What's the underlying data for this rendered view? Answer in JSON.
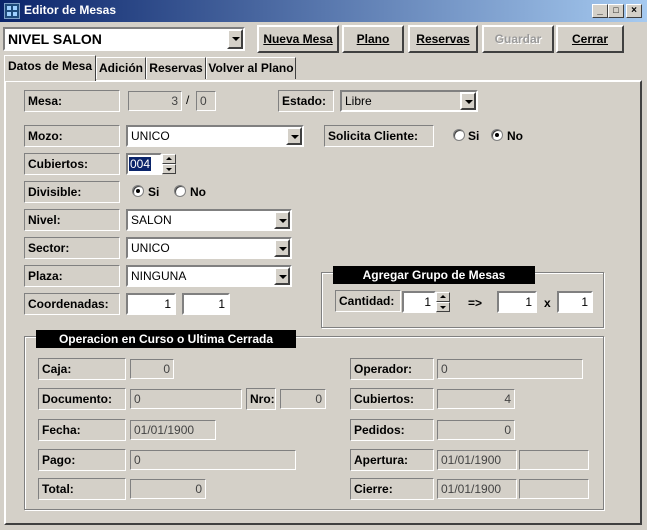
{
  "window": {
    "title": "Editor de Mesas",
    "min": "_",
    "max": "□",
    "close": "×"
  },
  "toolbar": {
    "nivel_value": "NIVEL SALON",
    "nueva_mesa": "Nueva Mesa",
    "plano": "Plano",
    "reservas": "Reservas",
    "guardar": "Guardar",
    "cerrar": "Cerrar"
  },
  "tabs": [
    "Datos de Mesa",
    "Adición",
    "Reservas",
    "Volver al Plano"
  ],
  "form": {
    "mesa_label": "Mesa:",
    "mesa_value": "3",
    "mesa_sep": "/",
    "mesa_value2": "0",
    "estado_label": "Estado:",
    "estado_value": "Libre",
    "mozo_label": "Mozo:",
    "mozo_value": "UNICO",
    "solicita_label": "Solicita Cliente:",
    "si": "Si",
    "no": "No",
    "cubiertos_label": "Cubiertos:",
    "cubiertos_value": "004",
    "divisible_label": "Divisible:",
    "nivel_label": "Nivel:",
    "nivel_value": "SALON",
    "sector_label": "Sector:",
    "sector_value": "UNICO",
    "plaza_label": "Plaza:",
    "plaza_value": "NINGUNA",
    "coordenadas_label": "Coordenadas:",
    "coord_x": "1",
    "coord_y": "1"
  },
  "grupo": {
    "title": "Agregar Grupo de Mesas",
    "cantidad_label": "Cantidad:",
    "cantidad_value": "1",
    "arrow": "=>",
    "x_value": "1",
    "times": "x",
    "y_value": "1"
  },
  "operacion": {
    "title": "Operacion en Curso o Ultima Cerrada",
    "caja_label": "Caja:",
    "caja_value": "0",
    "documento_label": "Documento:",
    "documento_value": "0",
    "nro_label": "Nro:",
    "nro_value": "0",
    "fecha_label": "Fecha:",
    "fecha_value": "01/01/1900",
    "pago_label": "Pago:",
    "pago_value": "0",
    "total_label": "Total:",
    "total_value": "0",
    "operador_label": "Operador:",
    "operador_value": "0",
    "cubiertos_label": "Cubiertos:",
    "cubiertos_value": "4",
    "pedidos_label": "Pedidos:",
    "pedidos_value": "0",
    "apertura_label": "Apertura:",
    "apertura_value": "01/01/1900",
    "apertura_extra": "",
    "cierre_label": "Cierre:",
    "cierre_value": "01/01/1900",
    "cierre_extra": ""
  }
}
